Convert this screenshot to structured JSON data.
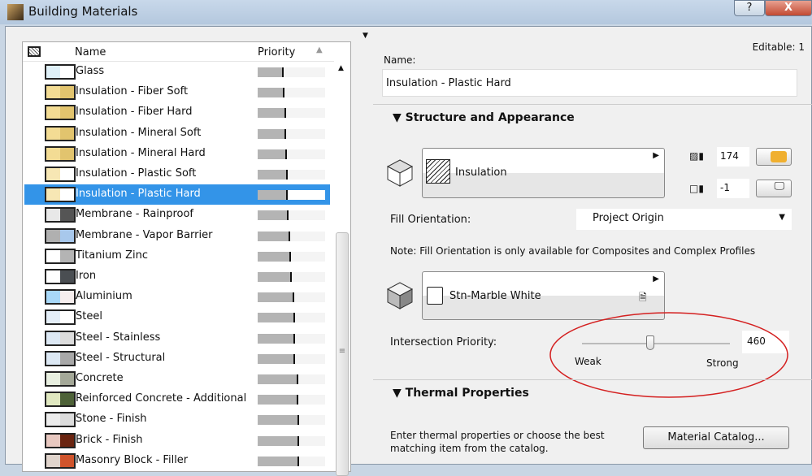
{
  "window": {
    "title": "Building Materials",
    "help_label": "?",
    "close_label": "X"
  },
  "list": {
    "header": {
      "name": "Name",
      "priority": "Priority"
    },
    "selected_index": 6,
    "items": [
      {
        "label": "Glass",
        "colors": [
          "#dff0f8",
          "#ffffff"
        ],
        "priority": 0.39
      },
      {
        "label": "Insulation - Fiber Soft",
        "colors": [
          "#f3dc94",
          "#e2c46e"
        ],
        "priority": 0.4
      },
      {
        "label": "Insulation - Fiber Hard",
        "colors": [
          "#f3dc94",
          "#e2c46e"
        ],
        "priority": 0.42
      },
      {
        "label": "Insulation - Mineral Soft",
        "colors": [
          "#f3dc94",
          "#e2c46e"
        ],
        "priority": 0.42
      },
      {
        "label": "Insulation - Mineral Hard",
        "colors": [
          "#f3dc94",
          "#e2c46e"
        ],
        "priority": 0.43
      },
      {
        "label": "Insulation - Plastic Soft",
        "colors": [
          "#f7e7b4",
          "#ffffff"
        ],
        "priority": 0.45
      },
      {
        "label": "Insulation - Plastic Hard",
        "colors": [
          "#f7e7b4",
          "#ffffff"
        ],
        "priority": 0.45
      },
      {
        "label": "Membrane - Rainproof",
        "colors": [
          "#e8e8e8",
          "#555555"
        ],
        "priority": 0.46
      },
      {
        "label": "Membrane - Vapor Barrier",
        "colors": [
          "#b0b0b0",
          "#a8c8ec"
        ],
        "priority": 0.48
      },
      {
        "label": "Titanium Zinc",
        "colors": [
          "#ffffff",
          "#b4b4b4"
        ],
        "priority": 0.49
      },
      {
        "label": "Iron",
        "colors": [
          "#ffffff",
          "#4a4e52"
        ],
        "priority": 0.5
      },
      {
        "label": "Aluminium",
        "colors": [
          "#a8d8f8",
          "#f6eeee"
        ],
        "priority": 0.54
      },
      {
        "label": "Steel",
        "colors": [
          "#e4eef8",
          "#ffffff"
        ],
        "priority": 0.55
      },
      {
        "label": "Steel - Stainless",
        "colors": [
          "#dce8f4",
          "#dcdcdc"
        ],
        "priority": 0.56
      },
      {
        "label": "Steel - Structural",
        "colors": [
          "#dce8f4",
          "#a8a8a8"
        ],
        "priority": 0.56
      },
      {
        "label": "Concrete",
        "colors": [
          "#e8efe0",
          "#a4a898"
        ],
        "priority": 0.6
      },
      {
        "label": "Reinforced Concrete - Additional",
        "colors": [
          "#e0e8c0",
          "#4e6238"
        ],
        "priority": 0.6
      },
      {
        "label": "Stone - Finish",
        "colors": [
          "#ececec",
          "#dcdcdc"
        ],
        "priority": 0.61
      },
      {
        "label": "Brick - Finish",
        "colors": [
          "#e8c8c0",
          "#6a2410"
        ],
        "priority": 0.61
      },
      {
        "label": "Masonry Block - Filler",
        "colors": [
          "#e0d4cc",
          "#d0542c"
        ],
        "priority": 0.62
      }
    ]
  },
  "details": {
    "editable": "Editable: 1",
    "name_label": "Name:",
    "name_value": "Insulation - Plastic Hard",
    "structure_title": "Structure and Appearance",
    "cut_fill": "Insulation",
    "cut_fill_pen": "174",
    "bg_pen": "-1",
    "pen_color": "#f0b030",
    "fill_orientation_label": "Fill Orientation:",
    "fill_orientation_value": "Project Origin",
    "note": "Note: Fill Orientation is only available for Composites and Complex Profiles",
    "surface": "Stn-Marble White",
    "intersection_label": "Intersection Priority:",
    "intersection_value": "460",
    "weak": "Weak",
    "strong": "Strong",
    "thermal_title": "Thermal Properties",
    "thermal_text": "Enter thermal properties or choose the best matching item from the catalog.",
    "catalog_button": "Material Catalog..."
  }
}
